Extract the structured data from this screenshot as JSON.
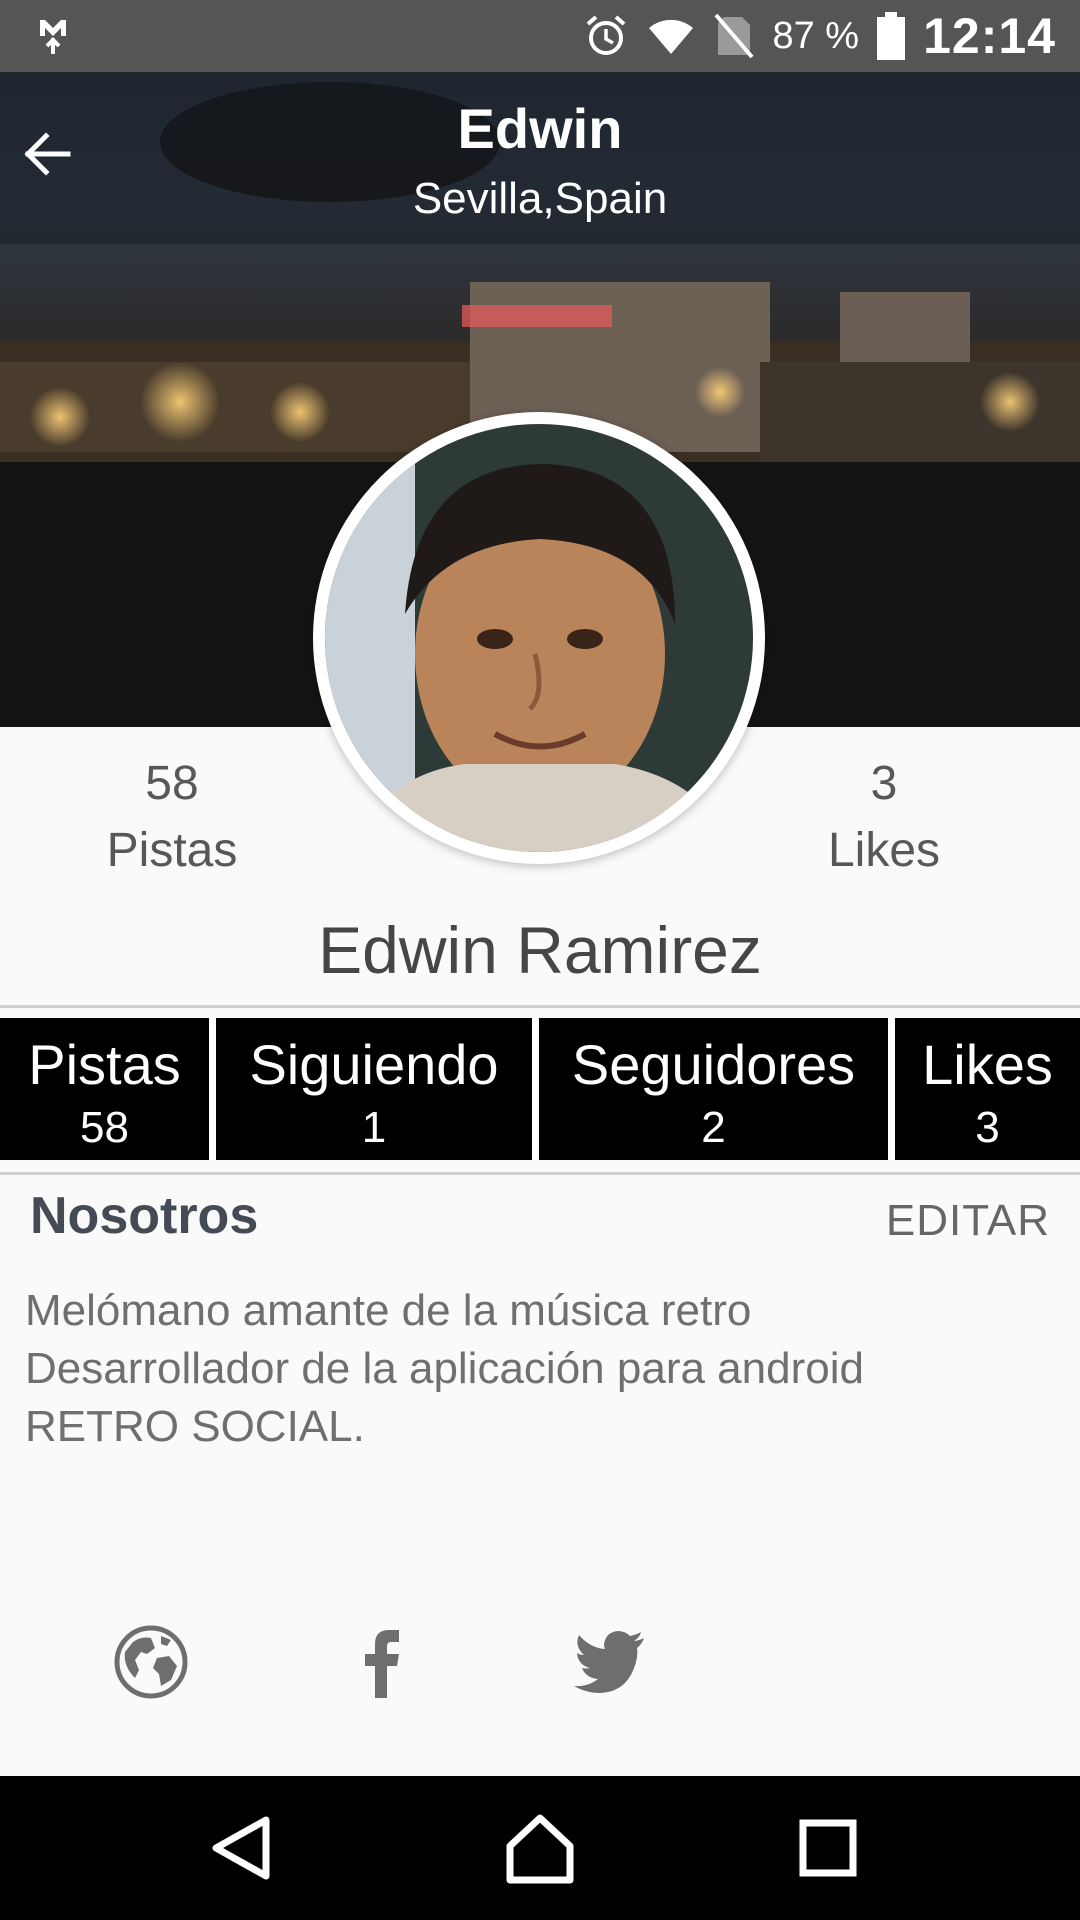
{
  "status_bar": {
    "battery_percent": "87 %",
    "time": "12:14",
    "icons": [
      "gmail-icon",
      "alarm-icon",
      "wifi-icon",
      "no-sim-icon",
      "battery-icon"
    ]
  },
  "header": {
    "title": "Edwin",
    "subtitle": "Sevilla,Spain"
  },
  "profile": {
    "left_stat": {
      "value": "58",
      "label": "Pistas"
    },
    "right_stat": {
      "value": "3",
      "label": "Likes"
    },
    "full_name": "Edwin Ramirez"
  },
  "tabs": [
    {
      "label": "Pistas",
      "count": "58"
    },
    {
      "label": "Siguiendo",
      "count": "1"
    },
    {
      "label": "Seguidores",
      "count": "2"
    },
    {
      "label": "Likes",
      "count": "3"
    }
  ],
  "about": {
    "title": "Nosotros",
    "edit_label": "EDITAR",
    "bio_lines": [
      "Melómano amante de la música retro",
      "Desarrollador de la aplicación para android",
      "RETRO SOCIAL."
    ]
  },
  "social": [
    "globe-icon",
    "facebook-icon",
    "twitter-icon"
  ],
  "navigation": [
    "back-triangle-icon",
    "home-icon",
    "recents-icon"
  ],
  "colors": {
    "status_bar": "#555555",
    "tab_background": "#000000",
    "page_background": "#fafafa",
    "social_icon": "#6e6e6e"
  }
}
